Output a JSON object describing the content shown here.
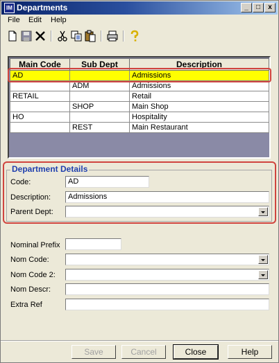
{
  "window": {
    "title": "Departments",
    "app_icon_text": "IM",
    "minimize_glyph": "_",
    "maximize_glyph": "□",
    "close_glyph": "x"
  },
  "menu": [
    "File",
    "Edit",
    "Help"
  ],
  "toolbar": {
    "icons": [
      "new-icon",
      "save-icon",
      "delete-icon",
      "cut-icon",
      "copy-icon",
      "paste-icon",
      "print-icon",
      "help-icon"
    ]
  },
  "grid": {
    "columns": [
      "Main Code",
      "Sub Dept",
      "Description"
    ],
    "rows": [
      [
        "AD",
        "",
        "Admissions"
      ],
      [
        "",
        "ADM",
        "Admissions"
      ],
      [
        "RETAIL",
        "",
        "Retail"
      ],
      [
        "",
        "SHOP",
        "Main Shop"
      ],
      [
        "HO",
        "",
        "Hospitality"
      ],
      [
        "",
        "REST",
        "Main Restaurant"
      ]
    ],
    "selected_row": 0,
    "selected_color": "#ffff00"
  },
  "department_details": {
    "title": "Department Details",
    "code_label": "Code:",
    "code_value": "AD",
    "description_label": "Description:",
    "description_value": "Admissions",
    "parent_label": "Parent Dept:",
    "parent_value": ""
  },
  "nominal": {
    "prefix_label": "Nominal Prefix",
    "prefix_value": "",
    "nom_code_label": "Nom Code:",
    "nom_code_value": "",
    "nom_code2_label": "Nom Code 2:",
    "nom_code2_value": "",
    "nom_descr_label": "Nom Descr:",
    "nom_descr_value": "",
    "extra_ref_label": "Extra Ref",
    "extra_ref_value": ""
  },
  "buttons": {
    "save": "Save",
    "cancel": "Cancel",
    "close": "Close",
    "help": "Help"
  },
  "colors": {
    "title_bar": "#0a246a",
    "highlight_outline": "#d0443e",
    "group_title": "#1f3fae"
  }
}
